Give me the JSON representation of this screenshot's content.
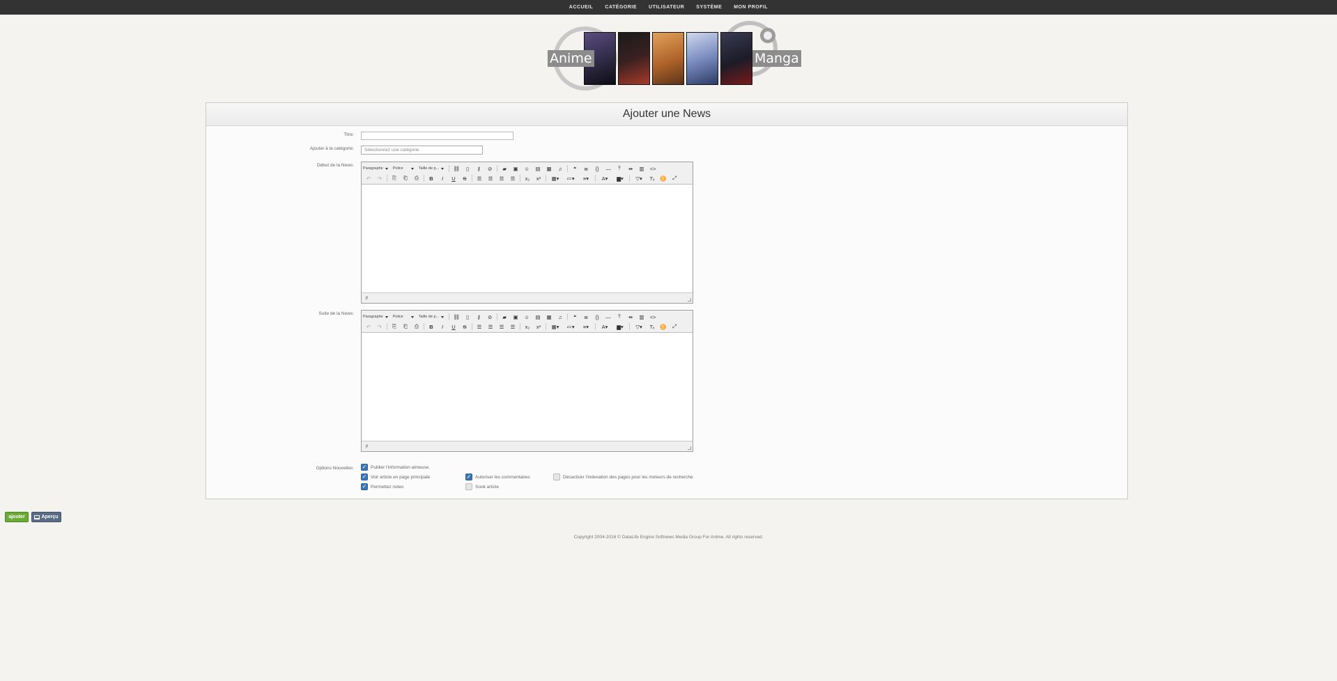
{
  "nav": {
    "items": [
      "ACCUEIL",
      "CATÉGORIE",
      "UTILISATEUR",
      "SYSTÈME",
      "MON PROFIL"
    ]
  },
  "banner": {
    "left_text": "Anime",
    "right_text": "Manga",
    "character_colors": [
      "#2b2740",
      "#3a2020",
      "#b0642a",
      "#4a5c8c",
      "#1b1b28"
    ]
  },
  "panel": {
    "title": "Ajouter une News"
  },
  "form": {
    "title_label": "Titre:",
    "category_label": "Ajouter à la catégorie:",
    "category_placeholder": "Sélectionnez une catégorie",
    "intro_label": "Début de la News:",
    "more_label": "Suite de la News:",
    "options_label": "Options Nouvelles:"
  },
  "editor": {
    "format_dropdown": "Paragraphe",
    "font_dropdown": "Police",
    "size_dropdown": "Taille de p...",
    "path_indicator": "p"
  },
  "options": [
    {
      "label": "Publier l'information aimeuse.",
      "checked": true
    },
    {
      "label": "Voir article en page principale",
      "checked": true
    },
    {
      "label": "Permettez notes",
      "checked": true
    },
    {
      "label": "Autoriser les commentaires",
      "checked": true
    },
    {
      "label": "Sook article",
      "checked": false
    },
    {
      "label": "Désactiver l'indexation des pages pour les moteurs de recherche",
      "checked": false
    }
  ],
  "buttons": {
    "add": "ajouter",
    "preview": "Aperçu"
  },
  "footer": {
    "text": "Copyright 2004-2016 © DataLife Engine Softnews Media Group For Anime. All rights reserved."
  },
  "colors": {
    "topbar": "#333333",
    "add_button": "#6aaa35",
    "preview_button": "#5b6d84",
    "checkbox_on": "#3b77b7"
  }
}
